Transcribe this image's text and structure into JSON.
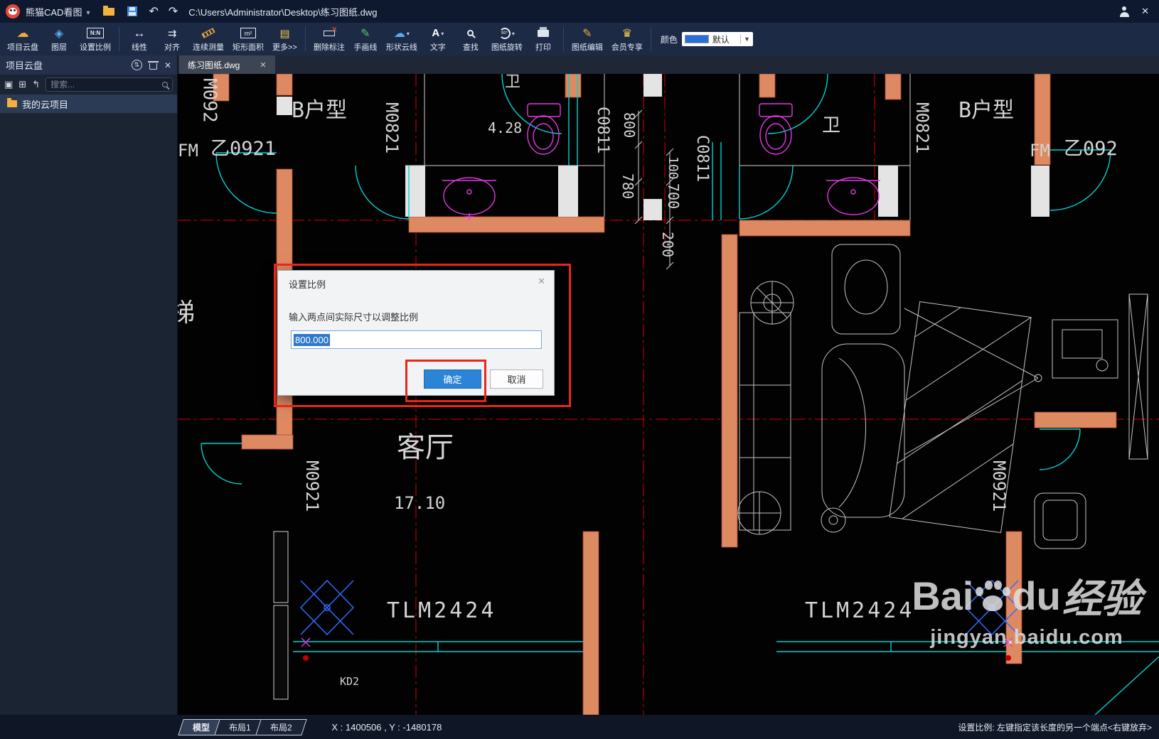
{
  "titlebar": {
    "app_name": "熊猫CAD看图",
    "file_path": "C:\\Users\\Administrator\\Desktop\\练习图纸.dwg"
  },
  "toolbar": {
    "items": [
      {
        "label": "项目云盘"
      },
      {
        "label": "图层"
      },
      {
        "label": "设置比例"
      },
      {
        "label": "线性"
      },
      {
        "label": "对齐"
      },
      {
        "label": "连续测量"
      },
      {
        "label": "矩形面积"
      },
      {
        "label": "更多>>"
      },
      {
        "label": "删除标注"
      },
      {
        "label": "手画线"
      },
      {
        "label": "形状云线"
      },
      {
        "label": "文字"
      },
      {
        "label": "查找"
      },
      {
        "label": "图纸旋转"
      },
      {
        "label": "打印"
      },
      {
        "label": "图纸编辑"
      },
      {
        "label": "会员专享"
      }
    ],
    "color_label": "颜色",
    "color_value": "默认"
  },
  "sidebar": {
    "title": "项目云盘",
    "search_placeholder": "搜索...",
    "items": [
      {
        "label": "我的云项目"
      }
    ]
  },
  "tabs": {
    "document": "练习图纸.dwg"
  },
  "dialog": {
    "title": "设置比例",
    "label": "输入两点间实际尺寸以调整比例",
    "input_value": "800.000",
    "ok": "确定",
    "cancel": "取消"
  },
  "statusbar": {
    "tabs": [
      "模型",
      "布局1",
      "布局2"
    ],
    "coords": "X : 1400506 , Y : -1480178",
    "hint": "设置比例: 左键指定该长度的另一个端点<右键放弃>"
  },
  "canvas": {
    "labels": [
      {
        "text": "M092"
      },
      {
        "text": "B户型"
      },
      {
        "text": "M0821"
      },
      {
        "text": "FM"
      },
      {
        "text": "乙0921"
      },
      {
        "text": "卫"
      },
      {
        "text": "4.28"
      },
      {
        "text": "C0811"
      },
      {
        "text": "800"
      },
      {
        "text": "780"
      },
      {
        "text": "100"
      },
      {
        "text": "700"
      },
      {
        "text": "200"
      },
      {
        "text": "C0811"
      },
      {
        "text": "卫"
      },
      {
        "text": "M0821"
      },
      {
        "text": "B户型"
      },
      {
        "text": "FM"
      },
      {
        "text": "乙092"
      },
      {
        "text": "M0921"
      },
      {
        "text": "客厅"
      },
      {
        "text": "17.10"
      },
      {
        "text": "M0921"
      },
      {
        "text": "TLM2424"
      },
      {
        "text": "TLM2424"
      },
      {
        "text": "KD2"
      },
      {
        "text": "梯"
      }
    ]
  },
  "watermark": {
    "brand_latin_1": "Bai",
    "brand_latin_2": "du",
    "brand_cn": "经验",
    "url": "jingyan.baidu.com"
  }
}
